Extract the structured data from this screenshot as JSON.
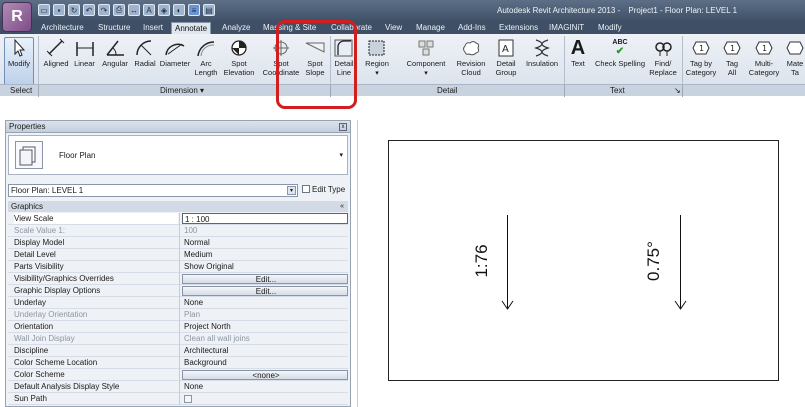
{
  "window": {
    "title": "Autodesk Revit Architecture 2013 -",
    "project": "Project1 - Floor Plan: LEVEL 1",
    "app_button": "R"
  },
  "quick_access": [
    "open-icon",
    "save-icon",
    "sync-icon",
    "undo-icon",
    "redo-icon",
    "print-icon",
    "measure-icon",
    "text-icon",
    "3d-view-icon",
    "section-icon",
    "thin-lines-icon",
    "close-inactive-icon"
  ],
  "tabs": [
    {
      "label": "Architecture"
    },
    {
      "label": "Structure"
    },
    {
      "label": "Insert"
    },
    {
      "label": "Annotate",
      "active": true
    },
    {
      "label": "Analyze"
    },
    {
      "label": "Massing & Site"
    },
    {
      "label": "Collaborate"
    },
    {
      "label": "View"
    },
    {
      "label": "Manage"
    },
    {
      "label": "Add-Ins"
    },
    {
      "label": "Extensions"
    },
    {
      "label": "IMAGINiT"
    },
    {
      "label": "Modify"
    }
  ],
  "ribbon": {
    "modify": "Modify",
    "dimension_tools": [
      {
        "label1": "Aligned",
        "label2": ""
      },
      {
        "label1": "Linear",
        "label2": ""
      },
      {
        "label1": "Angular",
        "label2": ""
      },
      {
        "label1": "Radial",
        "label2": ""
      },
      {
        "label1": "Diameter",
        "label2": ""
      },
      {
        "label1": "Arc",
        "label2": "Length"
      },
      {
        "label1": "Spot",
        "label2": "Elevation"
      },
      {
        "label1": "Spot",
        "label2": "Coordinate"
      },
      {
        "label1": "Spot",
        "label2": "Slope"
      }
    ],
    "detail_tools": [
      {
        "label1": "Detail",
        "label2": "Line"
      },
      {
        "label1": "Region",
        "label2": ""
      },
      {
        "label1": "Component",
        "label2": ""
      },
      {
        "label1": "Revision",
        "label2": "Cloud"
      },
      {
        "label1": "Detail",
        "label2": "Group"
      },
      {
        "label1": "Insulation",
        "label2": ""
      }
    ],
    "text_tools": [
      {
        "label1": "Text",
        "label2": ""
      },
      {
        "label1": "Check Spelling",
        "label2": ""
      },
      {
        "label1": "Find/",
        "label2": "Replace"
      }
    ],
    "tag_tools": [
      {
        "label1": "Tag by",
        "label2": "Category"
      },
      {
        "label1": "Tag",
        "label2": "All"
      },
      {
        "label1": "Multi-",
        "label2": "Category"
      },
      {
        "label1": "Mate",
        "label2": "Ta"
      }
    ],
    "panels": {
      "select": "Select",
      "dimension": "Dimension ▾",
      "detail": "Detail",
      "text": "Text",
      "text_launcher": "↘"
    },
    "abc_glyph": "ABC",
    "text_glyph": "A"
  },
  "properties": {
    "header": "Properties",
    "close": "x",
    "type_name": "Floor Plan",
    "instance": "Floor Plan: LEVEL 1",
    "edit_type": "Edit Type",
    "group": "Graphics",
    "group_toggle": "«",
    "rows": [
      {
        "name": "View Scale",
        "value": "1 : 100",
        "kind": "input",
        "selected": true
      },
      {
        "name": "Scale Value    1:",
        "value": "100",
        "kind": "text",
        "disabled": true
      },
      {
        "name": "Display Model",
        "value": "Normal",
        "kind": "text"
      },
      {
        "name": "Detail Level",
        "value": "Medium",
        "kind": "text"
      },
      {
        "name": "Parts Visibility",
        "value": "Show Original",
        "kind": "text"
      },
      {
        "name": "Visibility/Graphics Overrides",
        "value": "Edit...",
        "kind": "button"
      },
      {
        "name": "Graphic Display Options",
        "value": "Edit...",
        "kind": "button"
      },
      {
        "name": "Underlay",
        "value": "None",
        "kind": "text"
      },
      {
        "name": "Underlay Orientation",
        "value": "Plan",
        "kind": "text",
        "disabled": true
      },
      {
        "name": "Orientation",
        "value": "Project North",
        "kind": "text"
      },
      {
        "name": "Wall Join Display",
        "value": "Clean all wall joins",
        "kind": "text",
        "disabled": true
      },
      {
        "name": "Discipline",
        "value": "Architectural",
        "kind": "text"
      },
      {
        "name": "Color Scheme Location",
        "value": "Background",
        "kind": "text"
      },
      {
        "name": "Color Scheme",
        "value": "<none>",
        "kind": "button"
      },
      {
        "name": "Default Analysis Display Style",
        "value": "None",
        "kind": "text"
      },
      {
        "name": "Sun Path",
        "value": "",
        "kind": "checkbox"
      }
    ]
  },
  "drawing": {
    "spot_slope_left": "1:76",
    "spot_slope_right": "0.75°"
  },
  "colors": {
    "highlight": "#d11f1f",
    "titlebar": "#3e4f66",
    "ribbon": "#e4e9f0"
  }
}
